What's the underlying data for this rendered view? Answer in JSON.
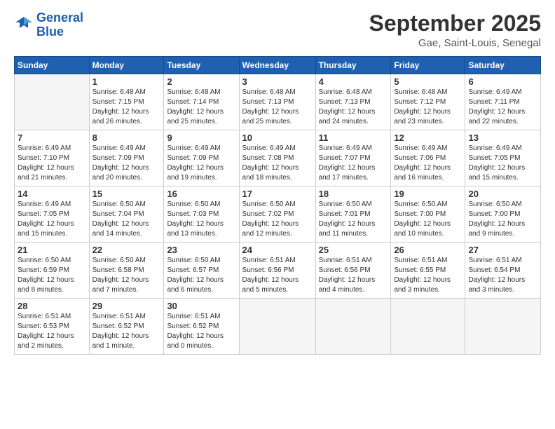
{
  "logo": {
    "text_general": "General",
    "text_blue": "Blue"
  },
  "header": {
    "month_year": "September 2025",
    "location": "Gae, Saint-Louis, Senegal"
  },
  "days_of_week": [
    "Sunday",
    "Monday",
    "Tuesday",
    "Wednesday",
    "Thursday",
    "Friday",
    "Saturday"
  ],
  "weeks": [
    [
      {
        "day": "",
        "info": ""
      },
      {
        "day": "1",
        "info": "Sunrise: 6:48 AM\nSunset: 7:15 PM\nDaylight: 12 hours\nand 26 minutes."
      },
      {
        "day": "2",
        "info": "Sunrise: 6:48 AM\nSunset: 7:14 PM\nDaylight: 12 hours\nand 25 minutes."
      },
      {
        "day": "3",
        "info": "Sunrise: 6:48 AM\nSunset: 7:13 PM\nDaylight: 12 hours\nand 25 minutes."
      },
      {
        "day": "4",
        "info": "Sunrise: 6:48 AM\nSunset: 7:13 PM\nDaylight: 12 hours\nand 24 minutes."
      },
      {
        "day": "5",
        "info": "Sunrise: 6:48 AM\nSunset: 7:12 PM\nDaylight: 12 hours\nand 23 minutes."
      },
      {
        "day": "6",
        "info": "Sunrise: 6:49 AM\nSunset: 7:11 PM\nDaylight: 12 hours\nand 22 minutes."
      }
    ],
    [
      {
        "day": "7",
        "info": "Sunrise: 6:49 AM\nSunset: 7:10 PM\nDaylight: 12 hours\nand 21 minutes."
      },
      {
        "day": "8",
        "info": "Sunrise: 6:49 AM\nSunset: 7:09 PM\nDaylight: 12 hours\nand 20 minutes."
      },
      {
        "day": "9",
        "info": "Sunrise: 6:49 AM\nSunset: 7:09 PM\nDaylight: 12 hours\nand 19 minutes."
      },
      {
        "day": "10",
        "info": "Sunrise: 6:49 AM\nSunset: 7:08 PM\nDaylight: 12 hours\nand 18 minutes."
      },
      {
        "day": "11",
        "info": "Sunrise: 6:49 AM\nSunset: 7:07 PM\nDaylight: 12 hours\nand 17 minutes."
      },
      {
        "day": "12",
        "info": "Sunrise: 6:49 AM\nSunset: 7:06 PM\nDaylight: 12 hours\nand 16 minutes."
      },
      {
        "day": "13",
        "info": "Sunrise: 6:49 AM\nSunset: 7:05 PM\nDaylight: 12 hours\nand 15 minutes."
      }
    ],
    [
      {
        "day": "14",
        "info": "Sunrise: 6:49 AM\nSunset: 7:05 PM\nDaylight: 12 hours\nand 15 minutes."
      },
      {
        "day": "15",
        "info": "Sunrise: 6:50 AM\nSunset: 7:04 PM\nDaylight: 12 hours\nand 14 minutes."
      },
      {
        "day": "16",
        "info": "Sunrise: 6:50 AM\nSunset: 7:03 PM\nDaylight: 12 hours\nand 13 minutes."
      },
      {
        "day": "17",
        "info": "Sunrise: 6:50 AM\nSunset: 7:02 PM\nDaylight: 12 hours\nand 12 minutes."
      },
      {
        "day": "18",
        "info": "Sunrise: 6:50 AM\nSunset: 7:01 PM\nDaylight: 12 hours\nand 11 minutes."
      },
      {
        "day": "19",
        "info": "Sunrise: 6:50 AM\nSunset: 7:00 PM\nDaylight: 12 hours\nand 10 minutes."
      },
      {
        "day": "20",
        "info": "Sunrise: 6:50 AM\nSunset: 7:00 PM\nDaylight: 12 hours\nand 9 minutes."
      }
    ],
    [
      {
        "day": "21",
        "info": "Sunrise: 6:50 AM\nSunset: 6:59 PM\nDaylight: 12 hours\nand 8 minutes."
      },
      {
        "day": "22",
        "info": "Sunrise: 6:50 AM\nSunset: 6:58 PM\nDaylight: 12 hours\nand 7 minutes."
      },
      {
        "day": "23",
        "info": "Sunrise: 6:50 AM\nSunset: 6:57 PM\nDaylight: 12 hours\nand 6 minutes."
      },
      {
        "day": "24",
        "info": "Sunrise: 6:51 AM\nSunset: 6:56 PM\nDaylight: 12 hours\nand 5 minutes."
      },
      {
        "day": "25",
        "info": "Sunrise: 6:51 AM\nSunset: 6:56 PM\nDaylight: 12 hours\nand 4 minutes."
      },
      {
        "day": "26",
        "info": "Sunrise: 6:51 AM\nSunset: 6:55 PM\nDaylight: 12 hours\nand 3 minutes."
      },
      {
        "day": "27",
        "info": "Sunrise: 6:51 AM\nSunset: 6:54 PM\nDaylight: 12 hours\nand 3 minutes."
      }
    ],
    [
      {
        "day": "28",
        "info": "Sunrise: 6:51 AM\nSunset: 6:53 PM\nDaylight: 12 hours\nand 2 minutes."
      },
      {
        "day": "29",
        "info": "Sunrise: 6:51 AM\nSunset: 6:52 PM\nDaylight: 12 hours\nand 1 minute."
      },
      {
        "day": "30",
        "info": "Sunrise: 6:51 AM\nSunset: 6:52 PM\nDaylight: 12 hours\nand 0 minutes."
      },
      {
        "day": "",
        "info": ""
      },
      {
        "day": "",
        "info": ""
      },
      {
        "day": "",
        "info": ""
      },
      {
        "day": "",
        "info": ""
      }
    ]
  ]
}
